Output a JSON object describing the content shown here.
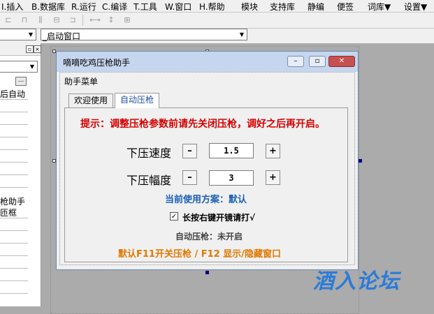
{
  "ide": {
    "menu": [
      "I.插入",
      "B.数据库",
      "R.运行",
      "C.编译",
      "T.工具",
      "W.窗口",
      "H.帮助",
      "模块",
      "支持库",
      "静编",
      "便签",
      "词库▼",
      "设置▼"
    ],
    "combo_right": "_启动窗口",
    "left_panel_rows": [
      "后自动",
      "",
      "",
      "",
      "",
      "",
      "",
      "",
      "",
      "",
      "",
      "",
      "",
      "枪助手",
      "匝框"
    ],
    "left_panel_ellipsis": "..."
  },
  "app_window": {
    "title": "嘀嘀吃鸡压枪助手",
    "controls": {
      "minimize": "–",
      "maximize": "▫",
      "close": "✕"
    },
    "menu_label": "助手菜单",
    "tabs": [
      "欢迎使用",
      "自动压枪"
    ],
    "active_tab": "自动压枪",
    "notice": "提示：调整压枪参数前请先关闭压枪，调好之后再开启。",
    "speed": {
      "label": "下压速度",
      "minus": "–",
      "plus": "+",
      "value": "1.5"
    },
    "amplitude": {
      "label": "下压幅度",
      "minus": "–",
      "plus": "+",
      "value": "3"
    },
    "scheme": "当前使用方案：默认",
    "checkbox": {
      "label": "长按右键开镜请打√",
      "checked": true,
      "mark": "✓"
    },
    "status": "自动压枪：未开启",
    "hotkey_hint": "默认F11开关压枪 / F12 显示/隐藏窗口"
  },
  "watermark": "酒入论坛",
  "colors": {
    "notice": "#d40000",
    "scheme": "#1a5fb4",
    "hint": "#e07800",
    "watermark": "#2b7bd8",
    "title_bar": "#c5d6ee"
  }
}
